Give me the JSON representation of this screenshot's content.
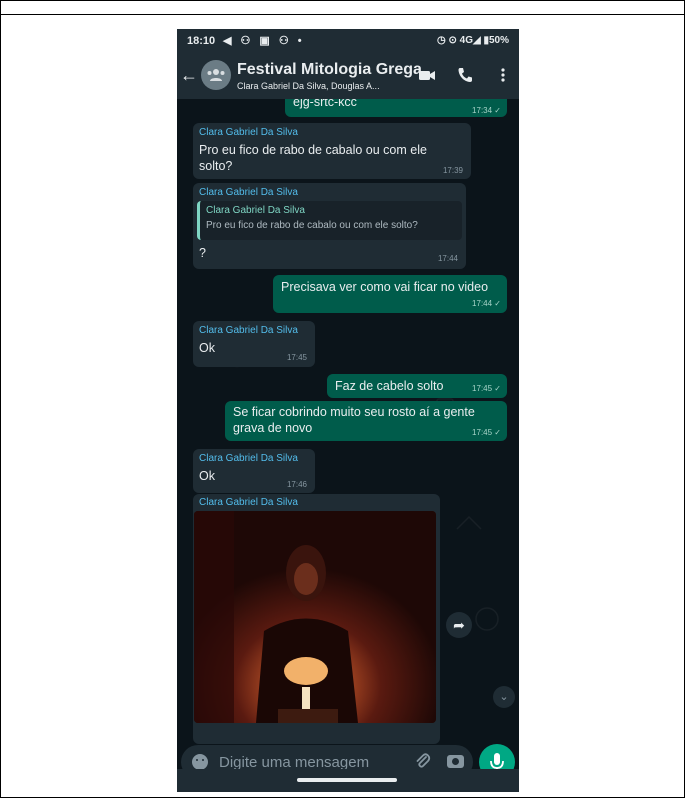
{
  "status": {
    "time": "18:10",
    "left_icons": "◀ ⚇ ▣ ⚇ •",
    "right_icons": "◷ ⊙ 4G◢ ▮50%"
  },
  "header": {
    "title": "Festival Mitologia Grega",
    "subtitle": "Clara Gabriel Da Silva, Douglas A..."
  },
  "messages": [
    {
      "dir": "out",
      "text": "ejg-srtc-kcc",
      "time": "17:34 ✓"
    },
    {
      "dir": "in",
      "sender": "Clara Gabriel Da Silva",
      "lines": [
        "Pro eu fico de rabo de cabalo ou com ele",
        "solto?"
      ],
      "time": "17:39"
    },
    {
      "dir": "in",
      "sender": "Clara Gabriel Da Silva",
      "quote_name": "Clara Gabriel Da Silva",
      "quote_text": "Pro eu fico de rabo de cabalo ou com ele solto?",
      "text": "?",
      "time": "17:44"
    },
    {
      "dir": "out",
      "text": "Precisava ver como vai ficar no video",
      "time": "17:44 ✓"
    },
    {
      "dir": "in",
      "sender": "Clara Gabriel Da Silva",
      "text": "Ok",
      "time": "17:45"
    },
    {
      "dir": "out",
      "text": "Faz de cabelo solto",
      "time": "17:45 ✓"
    },
    {
      "dir": "out",
      "lines": [
        "Se ficar cobrindo muito seu rosto aí a gente",
        "grava de novo"
      ],
      "time": "17:45 ✓"
    },
    {
      "dir": "in",
      "sender": "Clara Gabriel Da Silva",
      "text": "Ok",
      "time": "17:46"
    },
    {
      "dir": "in",
      "sender": "Clara Gabriel Da Silva",
      "type": "image"
    }
  ],
  "input": {
    "placeholder": "Digite uma mensagem"
  },
  "icons": {
    "back": "arrow-left-icon",
    "video": "video-camera-icon",
    "call": "phone-icon",
    "menu": "more-vert-icon",
    "forward": "share-forward-icon",
    "scroll": "chevron-double-down-icon",
    "emoji": "emoji-icon",
    "attach": "paperclip-icon",
    "camera": "camera-icon",
    "mic": "microphone-icon"
  },
  "colors": {
    "background": "#0b141a",
    "header": "#1f2c34",
    "incoming": "#1f2c34",
    "outgoing": "#005c4b",
    "accent": "#00a884",
    "sender_name": "#53bdeb"
  }
}
